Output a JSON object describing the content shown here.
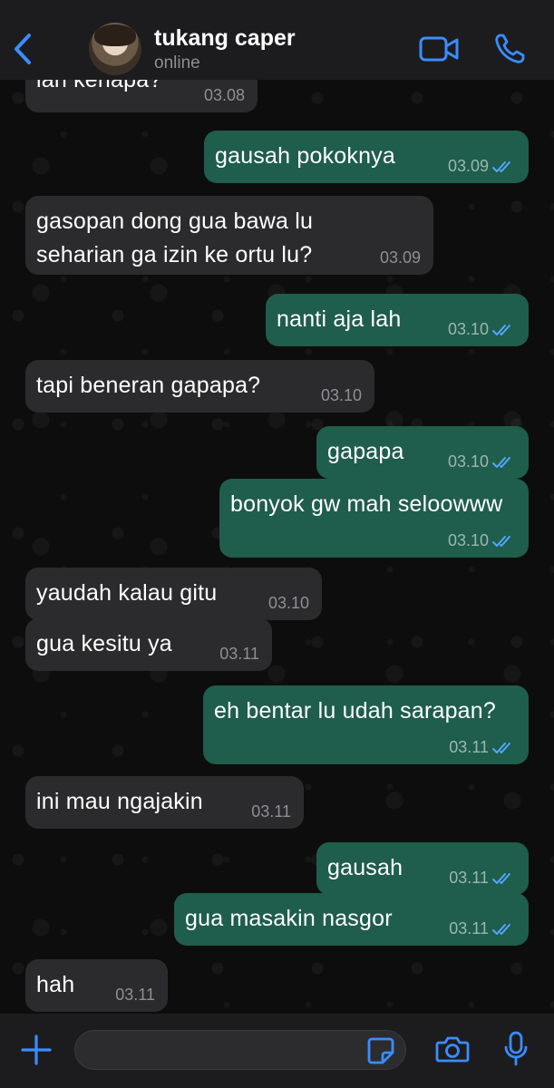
{
  "header": {
    "contact_name": "tukang caper",
    "status": "online",
    "icons": [
      "back-chevron-icon",
      "avatar",
      "video-camera-icon",
      "phone-icon"
    ]
  },
  "colors": {
    "accent": "#3a8dff",
    "incoming_bubble": "#2b2b2d",
    "outgoing_bubble": "#1f5d4c",
    "read_ticks": "#53a6ff"
  },
  "messages": [
    {
      "dir": "in",
      "lines": [
        "ian kenapa?"
      ],
      "time": "03.08"
    },
    {
      "dir": "out",
      "lines": [
        "gausah pokoknya"
      ],
      "time": "03.09",
      "read": true
    },
    {
      "dir": "in",
      "lines": [
        "gasopan dong gua bawa lu",
        "seharian ga izin ke ortu lu?"
      ],
      "time": "03.09"
    },
    {
      "dir": "out",
      "lines": [
        "nanti aja lah"
      ],
      "time": "03.10",
      "read": true
    },
    {
      "dir": "in",
      "lines": [
        "tapi beneran gapapa?"
      ],
      "time": "03.10"
    },
    {
      "dir": "out",
      "lines": [
        "gapapa"
      ],
      "time": "03.10",
      "read": true
    },
    {
      "dir": "out",
      "lines": [
        "bonyok gw mah seloowww"
      ],
      "time": "03.10",
      "read": true
    },
    {
      "dir": "in",
      "lines": [
        "yaudah kalau gitu"
      ],
      "time": "03.10"
    },
    {
      "dir": "in",
      "lines": [
        "gua kesitu ya"
      ],
      "time": "03.11"
    },
    {
      "dir": "out",
      "lines": [
        "eh bentar lu udah sarapan?"
      ],
      "time": "03.11",
      "read": true
    },
    {
      "dir": "in",
      "lines": [
        "ini mau ngajakin"
      ],
      "time": "03.11"
    },
    {
      "dir": "out",
      "lines": [
        "gausah"
      ],
      "time": "03.11",
      "read": true
    },
    {
      "dir": "out",
      "lines": [
        "gua masakin nasgor"
      ],
      "time": "03.11",
      "read": true
    },
    {
      "dir": "in",
      "lines": [
        "hah"
      ],
      "time": "03.11"
    }
  ],
  "input_bar": {
    "icons": [
      "plus-icon",
      "sticker-icon",
      "camera-icon",
      "microphone-icon"
    ]
  }
}
